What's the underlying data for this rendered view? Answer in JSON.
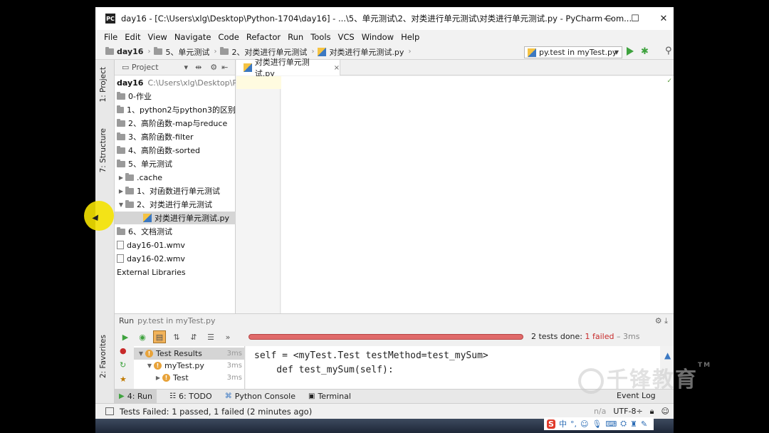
{
  "window": {
    "app_icon_text": "PC",
    "title": "day16 - [C:\\Users\\xlg\\Desktop\\Python-1704\\day16] - ...\\5、单元测试\\2、对类进行单元测试\\对类进行单元测试.py - PyCharm Com...",
    "minimize": "—",
    "maximize": "☐",
    "close": "✕"
  },
  "menu": [
    "File",
    "Edit",
    "View",
    "Navigate",
    "Code",
    "Refactor",
    "Run",
    "Tools",
    "VCS",
    "Window",
    "Help"
  ],
  "breadcrumb": [
    "day16",
    "5、单元测试",
    "2、对类进行单元测试",
    "对类进行单元测试.py"
  ],
  "toolbar": {
    "run_config": "py.test in myTest.py",
    "run_icon": "run-icon",
    "debug_icon": "debug-icon",
    "search_icon": "search-icon"
  },
  "side_tabs": {
    "project": "1: Project",
    "structure": "7: Structure",
    "favorites": "2: Favorites"
  },
  "project_panel": {
    "title": "Project",
    "root_name": "day16",
    "root_path": "C:\\Users\\xlg\\Desktop\\Py",
    "items": [
      {
        "label": "0-作业",
        "type": "folder"
      },
      {
        "label": "1、python2与python3的区别",
        "type": "folder"
      },
      {
        "label": "2、高阶函数-map与reduce",
        "type": "folder"
      },
      {
        "label": "3、高阶函数-filter",
        "type": "folder"
      },
      {
        "label": "4、高阶函数-sorted",
        "type": "folder"
      },
      {
        "label": "5、单元测试",
        "type": "folder"
      },
      {
        "label": ".cache",
        "type": "folder"
      },
      {
        "label": "1、对函数进行单元测试",
        "type": "folder"
      },
      {
        "label": "2、对类进行单元测试",
        "type": "folder"
      },
      {
        "label": "对类进行单元测试.py",
        "type": "py"
      },
      {
        "label": "6、文档测试",
        "type": "folder"
      },
      {
        "label": "day16-01.wmv",
        "type": "file"
      },
      {
        "label": "day16-02.wmv",
        "type": "file"
      },
      {
        "label": "External Libraries",
        "type": "lib"
      }
    ]
  },
  "editor": {
    "tab_label": "对类进行单元测试.py",
    "tab_close": "×"
  },
  "run_panel": {
    "label": "Run",
    "config": "py.test in myTest.py",
    "status_prefix": "2 tests done: ",
    "status_failed": "1 failed",
    "status_time": " – 3ms",
    "progress_failed": 1.0,
    "tree": [
      {
        "label": "Test Results",
        "time": "3ms"
      },
      {
        "label": "myTest.py",
        "time": "3ms"
      },
      {
        "label": "Test",
        "time": "3ms"
      }
    ],
    "console_line1": "self = <myTest.Test testMethod=test_mySum>",
    "console_line2": "    def test_mySum(self):"
  },
  "bottom_tabs": [
    {
      "label": "4: Run",
      "icon": "run-icon"
    },
    {
      "label": "6: TODO",
      "icon": "todo-icon"
    },
    {
      "label": "Python Console",
      "icon": "python-console-icon"
    },
    {
      "label": "Terminal",
      "icon": "terminal-icon"
    }
  ],
  "event_log": "Event Log",
  "statusbar": {
    "message": "Tests Failed: 1 passed, 1 failed (2 minutes ago)",
    "na": "n/a",
    "encoding": "UTF-8÷"
  },
  "tray": {
    "ime_brand": "S",
    "ime_lang": "中"
  },
  "watermark": "千锋教育"
}
